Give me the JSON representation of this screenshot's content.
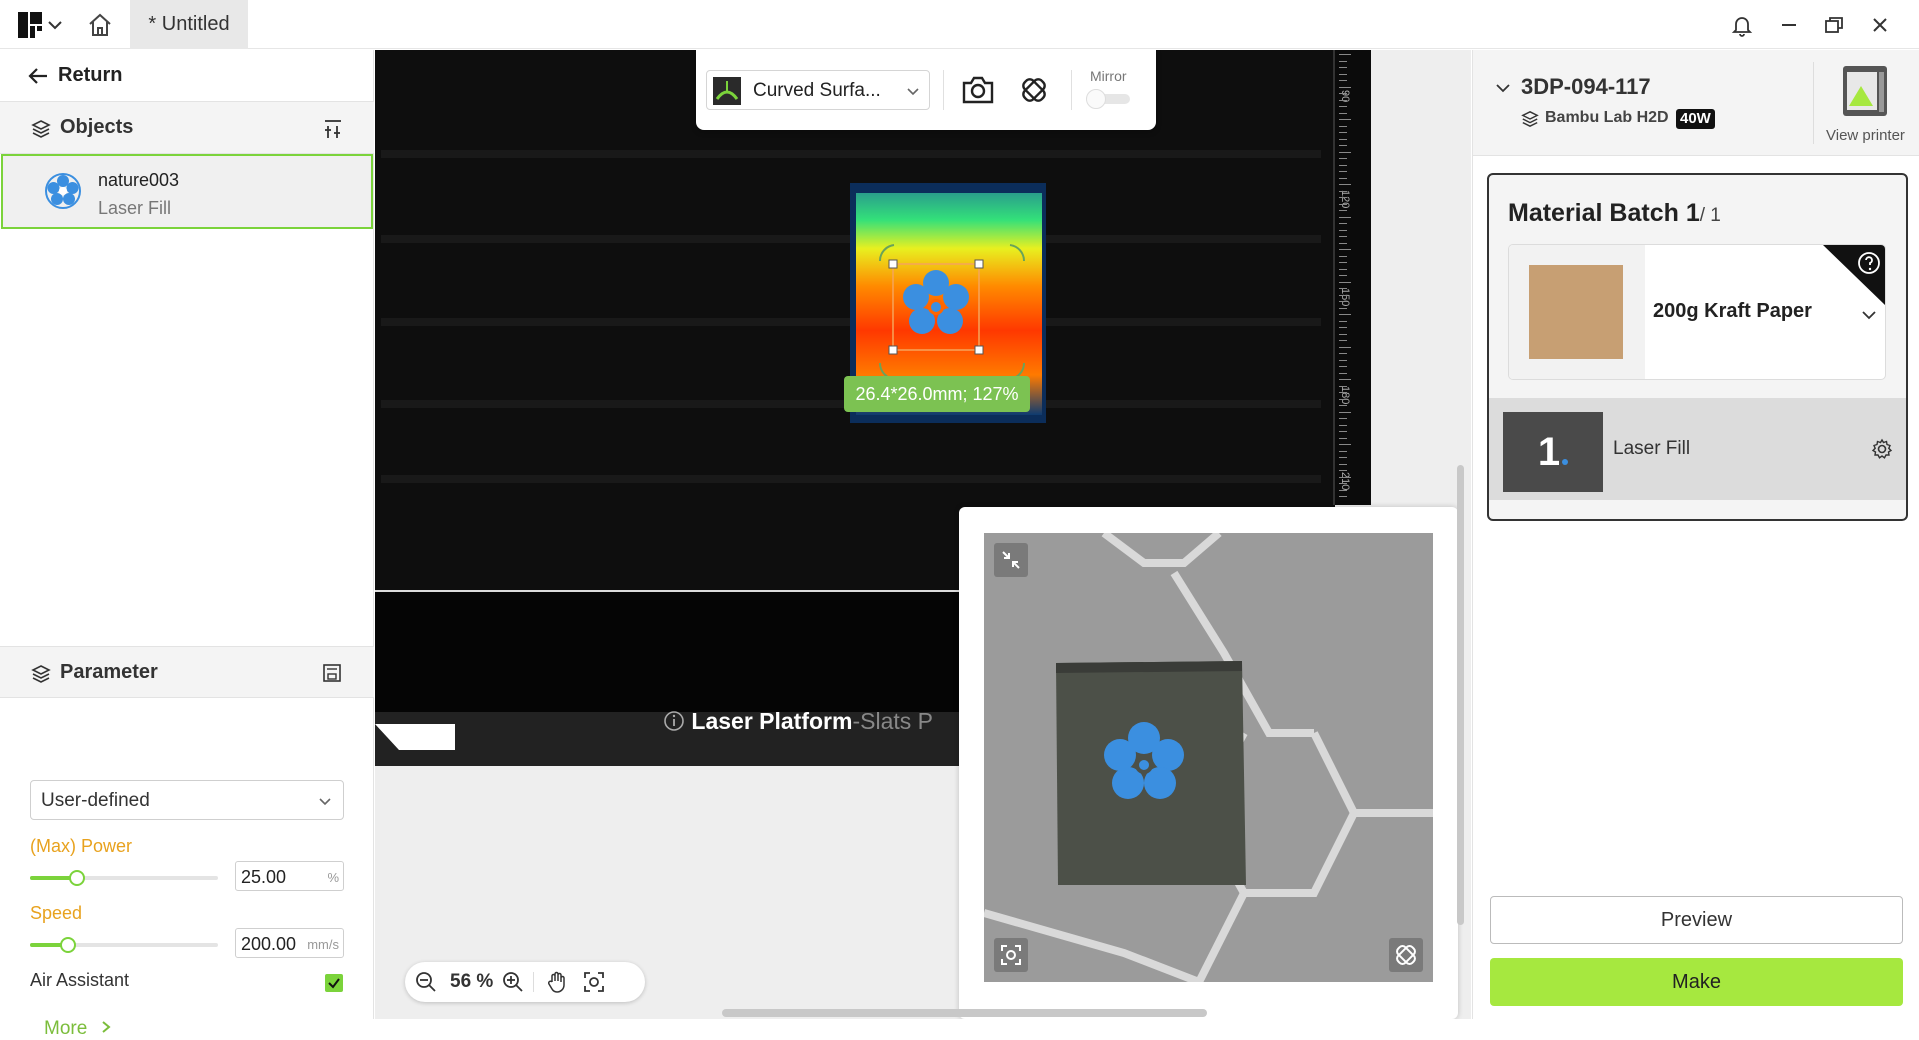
{
  "titlebar": {
    "tab_title": "* Untitled"
  },
  "left": {
    "return_label": "Return",
    "objects_label": "Objects",
    "object": {
      "name": "nature003",
      "type": "Laser Fill"
    },
    "parameter_label": "Parameter",
    "preset": "User-defined",
    "power": {
      "label": "(Max) Power",
      "value": "25.00",
      "unit": "%",
      "level": 0.25
    },
    "speed": {
      "label": "Speed",
      "value": "200.00",
      "unit": "mm/s",
      "level": 0.2
    },
    "air_assist_label": "Air Assistant",
    "air_assist_checked": true,
    "more_label": "More"
  },
  "canvas": {
    "mode": "Curved Surfa...",
    "mirror_label": "Mirror",
    "dimension_label": "26.4*26.0mm; 127%",
    "ruler_numbers": [
      "90",
      "120",
      "150",
      "180",
      "210"
    ],
    "platform_title": "Laser Platform",
    "platform_sub": "-Slats P",
    "zoom": "56 %"
  },
  "right": {
    "printer_name": "3DP-094-117",
    "printer_model": "Bambu Lab H2D",
    "power_badge": "40W",
    "view_printer": "View printer",
    "batch_title": "Material Batch 1",
    "batch_count": "/ 1",
    "material": "200g Kraft Paper",
    "layer_number": "1",
    "layer_label": "Laser Fill",
    "preview_label": "Preview",
    "make_label": "Make"
  },
  "colors": {
    "accent_green": "#7bd33b",
    "make_green": "#a6e83f",
    "param_orange": "#e8a21e",
    "icon_blue": "#3b8fe0"
  }
}
